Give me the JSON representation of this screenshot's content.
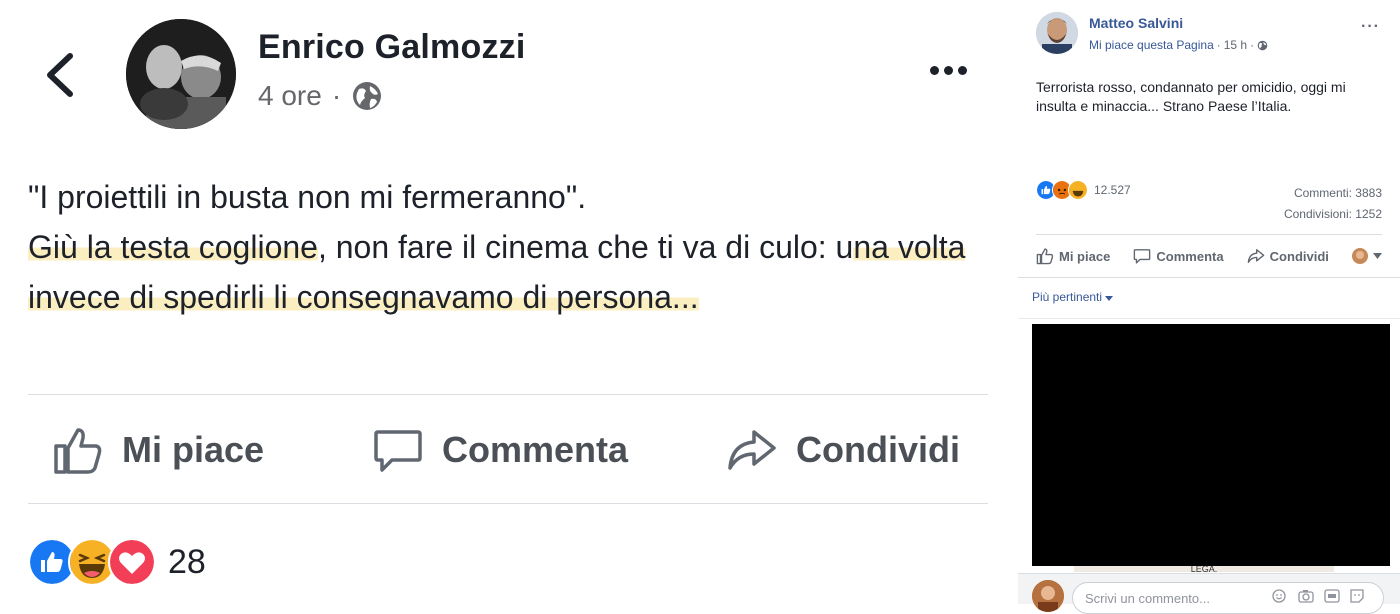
{
  "left_post": {
    "author": "Enrico Galmozzi",
    "time": "4 ore",
    "separator": "·",
    "text_line1": "\"I proiettili in busta non mi fermeranno\".",
    "text_p2_a": "Giù la testa coglione",
    "text_p2_b": ", non fare il cinema che ti va di culo: u",
    "text_p2_c": "na volta invece di spedirli li consegnavamo di persona...",
    "actions": {
      "like": "Mi piace",
      "comment": "Commenta",
      "share": "Condividi"
    },
    "reaction_count": "28",
    "highlight_color": "#fbeec0"
  },
  "right_post": {
    "page_name": "Matteo Salvini",
    "page_like_link": "Mi piace questa Pagina",
    "separator": "·",
    "time": "15 h",
    "more": "···",
    "text": "Terrorista rosso, condannato per omicidio, oggi mi insulta e minaccia... Strano Paese l’Italia.",
    "reaction_count": "12.527",
    "comments": "Commenti: 3883",
    "shares": "Condivisioni: 1252",
    "actions": {
      "like": "Mi piace",
      "comment": "Commenta",
      "share": "Condividi"
    },
    "filter": "Più pertinenti",
    "media_caption": "LEGA.",
    "comment_placeholder": "Scrivi un commento..."
  },
  "colors": {
    "link": "#385898",
    "like_blue": "#1877f2",
    "love_red": "#f33e58",
    "haha_yellow": "#f7b125"
  },
  "icons": [
    "back-chevron-icon",
    "globe-icon",
    "more-dots-icon",
    "like-thumb-icon",
    "comment-bubble-icon",
    "share-arrow-icon",
    "like-reaction-icon",
    "haha-reaction-icon",
    "love-reaction-icon",
    "angry-reaction-icon",
    "dropdown-caret-icon",
    "emoji-icon",
    "camera-icon",
    "gif-icon",
    "sticker-icon"
  ]
}
